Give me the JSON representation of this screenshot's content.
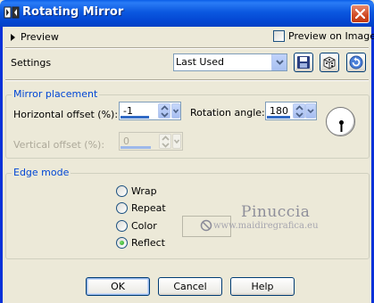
{
  "window": {
    "title": "Rotating Mirror"
  },
  "preview": {
    "toggle_label": "Preview",
    "checkbox_label": "Preview on Image",
    "checked": false
  },
  "settings": {
    "label": "Settings",
    "preset_value": "Last Used"
  },
  "toolbar_icons": [
    "save-icon",
    "randomize-dice-icon",
    "reset-icon"
  ],
  "mirror_placement": {
    "title": "Mirror placement",
    "horizontal_offset": {
      "label": "Horizontal offset (%):",
      "value": "-1"
    },
    "vertical_offset": {
      "label": "Vertical offset (%):",
      "value": "0",
      "disabled": true
    },
    "rotation_angle": {
      "label": "Rotation angle:",
      "value": "180"
    }
  },
  "edge_mode": {
    "title": "Edge mode",
    "options": [
      {
        "label": "Wrap",
        "selected": false
      },
      {
        "label": "Repeat",
        "selected": false
      },
      {
        "label": "Color",
        "selected": false
      },
      {
        "label": "Reflect",
        "selected": true
      }
    ]
  },
  "watermark": {
    "name": "Pinuccia",
    "url": "www.maidiregrafica.eu"
  },
  "buttons": {
    "ok": "OK",
    "cancel": "Cancel",
    "help": "Help"
  },
  "colors": {
    "titlebar": "#0a5ee8",
    "group_title": "#0046d5",
    "dialog_bg": "#ece9d8",
    "accent_bar": "#316ac5"
  }
}
